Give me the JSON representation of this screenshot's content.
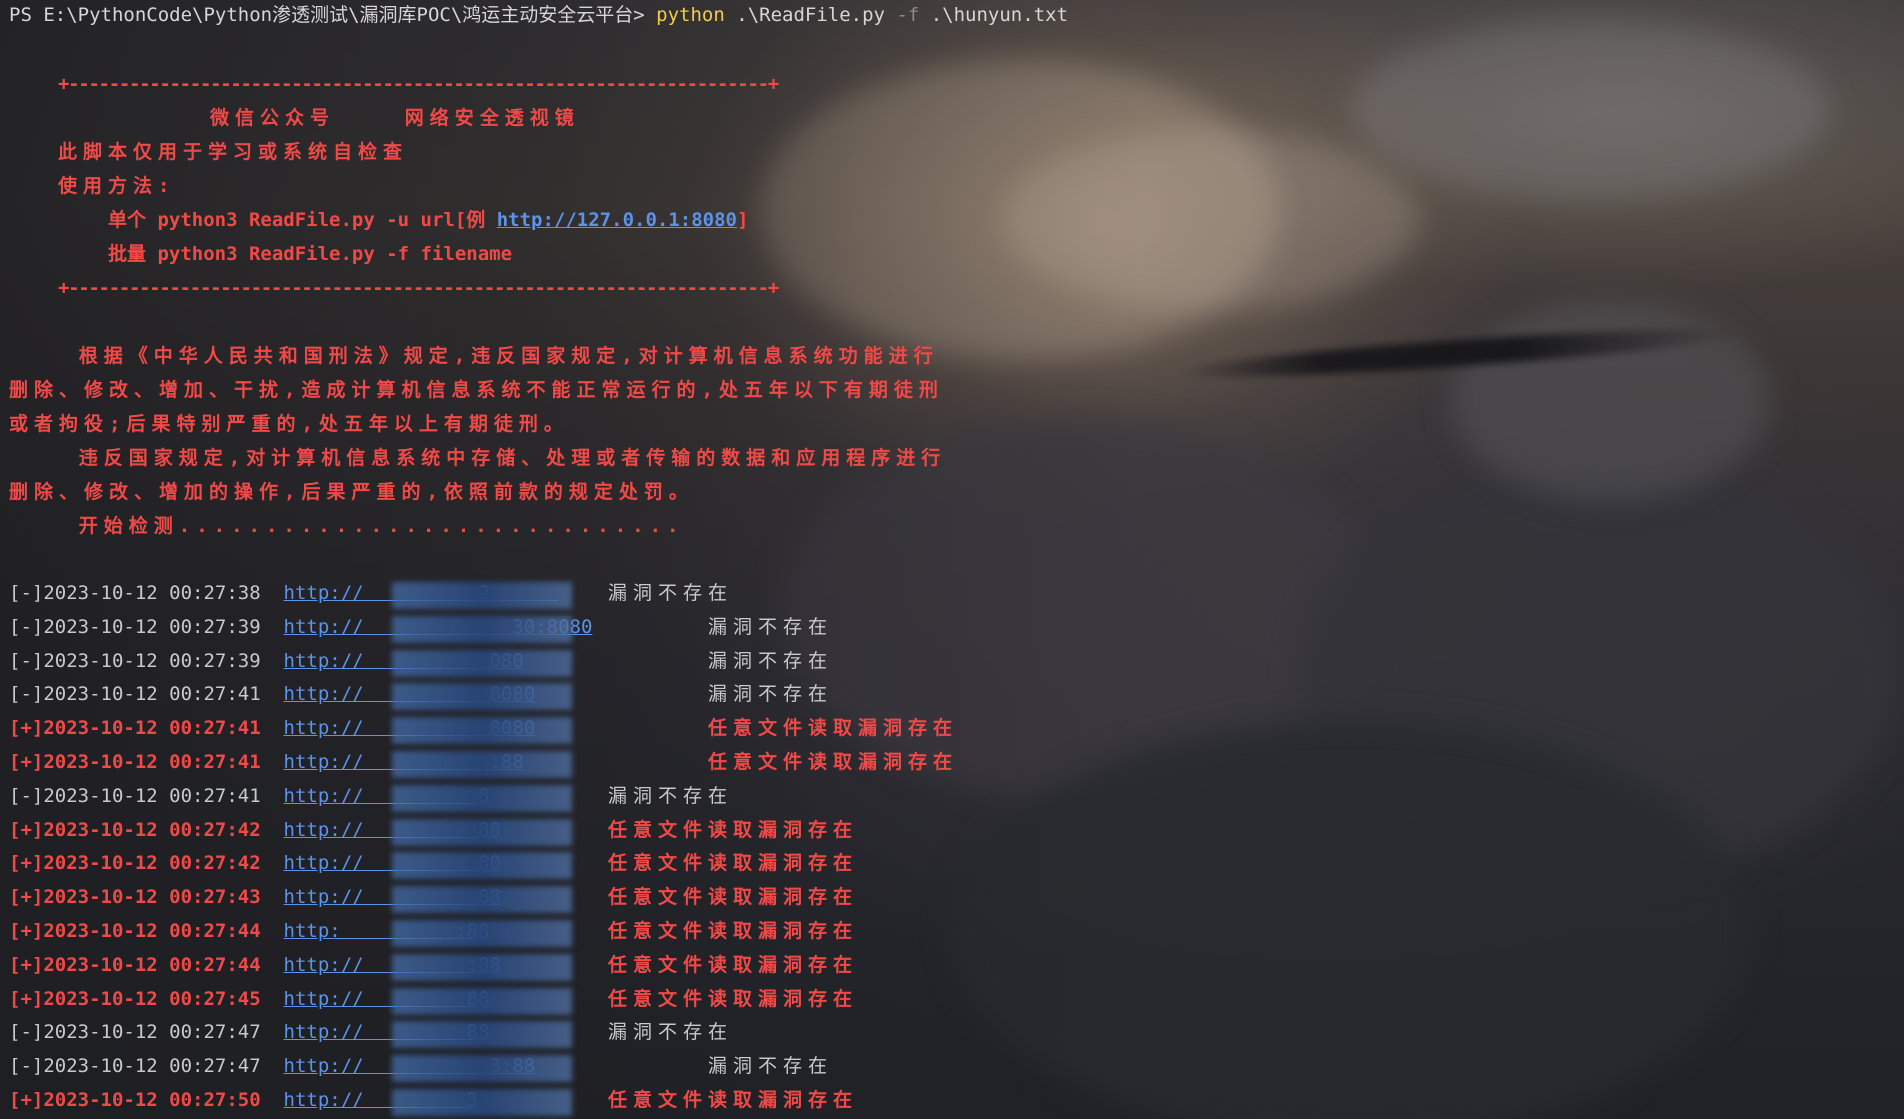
{
  "prompt": {
    "ps": "PS E:\\PythonCode\\Python渗透测试\\漏洞库POC\\鸿运主动安全云平台> ",
    "python": "python",
    "script": " .\\ReadFile.py ",
    "flag": "-f",
    "arg": " .\\hunyun.txt"
  },
  "banner": {
    "border": "+---------------------------------------------------------------------+",
    "line1": "微信公众号    网络安全透视镜",
    "line2": "此脚本仅用于学习或系统自检查",
    "line3": "使用方法:",
    "line4_prefix": "单个 python3 ReadFile.py -u url[例 ",
    "line4_link": "http://127.0.0.1:8080",
    "line4_suffix": "]",
    "line5": "批量 python3 ReadFile.py -f filename"
  },
  "legal": [
    "    根据《中华人民共和国刑法》规定,违反国家规定,对计算机信息系统功能进行",
    "删除、修改、增加、干扰,造成计算机信息系统不能正常运行的,处五年以下有期徒刑",
    "或者拘役;后果特别严重的,处五年以上有期徒刑。",
    "    违反国家规定,对计算机信息系统中存储、处理或者传输的数据和应用程序进行",
    "删除、修改、增加的操作,后果严重的,依照前款的规定处罚。",
    "    开始检测............................."
  ],
  "results": [
    {
      "status": "[-]",
      "time": "2023-10-12 00:27:38",
      "url": "http://          2      ",
      "msg": "漏洞不存在",
      "vuln": false
    },
    {
      "status": "[-]",
      "time": "2023-10-12 00:27:39",
      "url": "http://             30:8080",
      "msg": "漏洞不存在",
      "vuln": false
    },
    {
      "status": "[-]",
      "time": "2023-10-12 00:27:39",
      "url": "http://           080",
      "msg": "漏洞不存在",
      "vuln": false
    },
    {
      "status": "[-]",
      "time": "2023-10-12 00:27:41",
      "url": "http://           8080",
      "msg": "漏洞不存在",
      "vuln": false
    },
    {
      "status": "[+]",
      "time": "2023-10-12 00:27:41",
      "url": "http://           8080",
      "msg": "任意文件读取漏洞存在",
      "vuln": true
    },
    {
      "status": "[+]",
      "time": "2023-10-12 00:27:41",
      "url": "http://           :88",
      "msg": "任意文件读取漏洞存在",
      "vuln": true
    },
    {
      "status": "[-]",
      "time": "2023-10-12 00:27:41",
      "url": "http://          8",
      "msg": "漏洞不存在",
      "vuln": false
    },
    {
      "status": "[+]",
      "time": "2023-10-12 00:27:42",
      "url": "http://          88",
      "msg": "任意文件读取漏洞存在",
      "vuln": true
    },
    {
      "status": "[+]",
      "time": "2023-10-12 00:27:42",
      "url": "http://          80",
      "msg": "任意文件读取漏洞存在",
      "vuln": true
    },
    {
      "status": "[+]",
      "time": "2023-10-12 00:27:43",
      "url": "http://          88",
      "msg": "任意文件读取漏洞存在",
      "vuln": true
    },
    {
      "status": "[+]",
      "time": "2023-10-12 00:27:44",
      "url": "http:          :88",
      "msg": "任意文件读取漏洞存在",
      "vuln": true
    },
    {
      "status": "[+]",
      "time": "2023-10-12 00:27:44",
      "url": "http://         :88",
      "msg": "任意文件读取漏洞存在",
      "vuln": true
    },
    {
      "status": "[+]",
      "time": "2023-10-12 00:27:45",
      "url": "http://         88",
      "msg": "任意文件读取漏洞存在",
      "vuln": true
    },
    {
      "status": "[-]",
      "time": "2023-10-12 00:27:47",
      "url": "http://         88",
      "msg": "漏洞不存在",
      "vuln": false
    },
    {
      "status": "[-]",
      "time": "2023-10-12 00:27:47",
      "url": "http://           3:88",
      "msg": "漏洞不存在",
      "vuln": false
    },
    {
      "status": "[+]",
      "time": "2023-10-12 00:27:50",
      "url": "http://         3",
      "msg": "任意文件读取漏洞存在",
      "vuln": true
    }
  ],
  "colors": {
    "vuln": "#ef4a48",
    "safe": "#c9c9c9",
    "link": "#5b93ea",
    "python": "#f2cc47"
  }
}
